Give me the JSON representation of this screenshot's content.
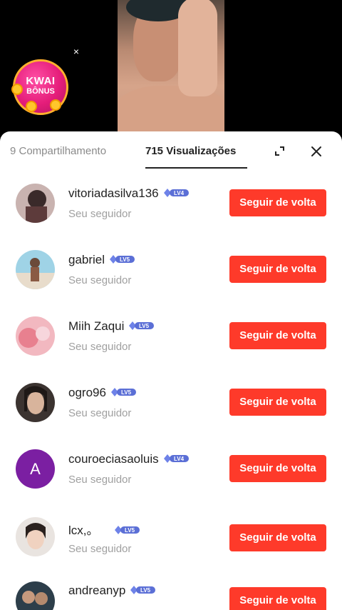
{
  "overlay": {
    "close_symbol": "×",
    "bonus": {
      "line1": "KWAI",
      "line2": "BÔNUS"
    }
  },
  "tabs": {
    "shares": "9 Compartilhamento",
    "views": "715 Visualizações",
    "active": "views"
  },
  "icons": {
    "expand": "expand-icon",
    "close": "close-icon",
    "level": "level-badge-icon"
  },
  "colors": {
    "follow_button": "#fe3a2a",
    "level_badge": "#5b6fd6",
    "avatar_letter_bg": "#7b1fa2"
  },
  "follow_label": "Seguir de volta",
  "subtitle": "Seu seguidor",
  "viewers": [
    {
      "name": "vitoriadasilva136",
      "level": "LV4",
      "avatar": "photo"
    },
    {
      "name": "gabriel",
      "level": "LV5",
      "avatar": "photo"
    },
    {
      "name": "Miih Zaqui",
      "level": "LV5",
      "avatar": "photo"
    },
    {
      "name": "ogro96",
      "level": "LV5",
      "avatar": "photo"
    },
    {
      "name": "couroeciasaoluis",
      "level": "LV4",
      "avatar": "A"
    },
    {
      "name": "lcx,。",
      "level": "LV5",
      "avatar": "photo"
    },
    {
      "name": "andreanyp",
      "level": "LV5",
      "avatar": "photo"
    }
  ]
}
